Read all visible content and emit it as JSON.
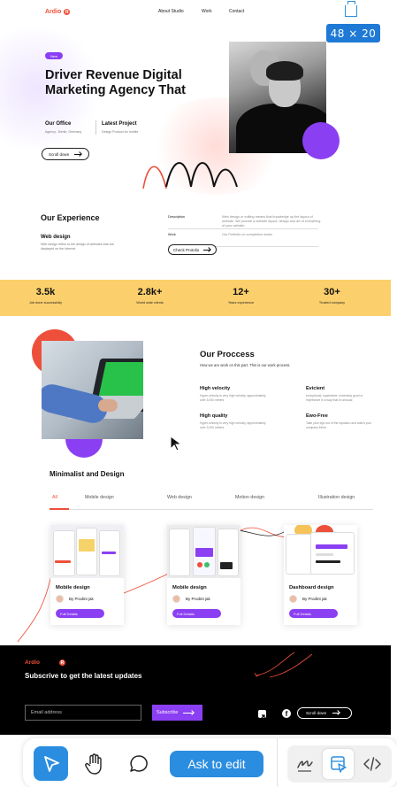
{
  "nav": {
    "logo": "Ardio",
    "logo_mark": "R",
    "links": [
      "About Studio",
      "Work",
      "Contact"
    ]
  },
  "overlay": {
    "size_badge": "48 × 20"
  },
  "hero": {
    "tag": "New",
    "title": "Driver Revenue Digital Marketing Agency That",
    "office_title": "Our Office",
    "office_sub": "Agency - Berlin, Germany",
    "project_title": "Latest Project",
    "project_sub": "Design Product for mobile",
    "scroll_label": "Scroll down"
  },
  "experience": {
    "title": "Our Experience",
    "sub_title": "Web design",
    "sub_desc": "Web design refers to the design of websites that are displayed on the Internet",
    "rows": [
      {
        "key": "Description",
        "value": "Web design or editing means that knowledge up the layout of website. We provide a website layout, design and art of everything of your website."
      },
      {
        "key": "Work",
        "value": "Our Portfolio on completion works"
      }
    ],
    "portfolio_label": "Check Protolio"
  },
  "stats": [
    {
      "num": "3.5k",
      "label": "Job done successfully"
    },
    {
      "num": "2.8k+",
      "label": "World wide clients"
    },
    {
      "num": "12+",
      "label": "Years experience"
    },
    {
      "num": "30+",
      "label": "Trusted company"
    }
  ],
  "process": {
    "title": "Our Proccess",
    "subtitle": "How we are work on this part. This is our work process.",
    "features": [
      {
        "title": "High velocity",
        "desc": "Hyper-velocity is very high velocity, approximately over 3,000 meters"
      },
      {
        "title": "Evicient",
        "desc": "exceptional; superlative; extremely good or impressive in a way that is unusual"
      },
      {
        "title": "High quality",
        "desc": "Hyper-velocity is very high velocity, approximately over 3,000 meters"
      },
      {
        "title": "Ewo-Free",
        "desc": "Take your ego out of the equation and watch your company thrive"
      }
    ]
  },
  "portfolio": {
    "title": "Minimalist and Design",
    "tabs": [
      "All",
      "Mobile design",
      "Web design",
      "Motion design",
      "Illustration design"
    ],
    "active_tab": "All",
    "cards": [
      {
        "name": "Mobile design",
        "author": "By Prodint jak",
        "button": "Full Details"
      },
      {
        "name": "Mobile design",
        "author": "By Prodint jak",
        "button": "Full Details"
      },
      {
        "name": "Dashboard design",
        "author": "By Prodint jak",
        "button": "Full Details"
      }
    ]
  },
  "footer": {
    "logo": "Ardio",
    "logo_mark": "R",
    "title": "Subscrive to get the latest updates",
    "email_placeholder": "Email address",
    "subscribe_label": "Subscribe",
    "facebook_glyph": "f",
    "scroll_label": "Scroll down"
  },
  "toolbar": {
    "ask_label": "Ask to edit"
  },
  "colors": {
    "accent_red": "#ee4f3a",
    "accent_purple": "#8b3ff3",
    "stats_yellow": "#fbd06c",
    "tool_blue": "#2b8de0"
  },
  "icons": [
    "select-pointer-icon",
    "hand-icon",
    "comment-icon",
    "draw-icon",
    "edit-select-icon",
    "code-icon",
    "resize-handle-icon",
    "share-icon",
    "facebook-icon"
  ]
}
